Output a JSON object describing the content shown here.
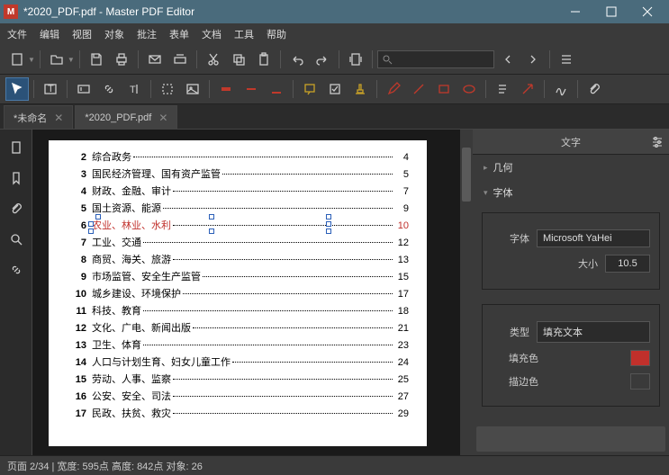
{
  "title": "*2020_PDF.pdf - Master PDF Editor",
  "menu": [
    "文件",
    "编辑",
    "视图",
    "对象",
    "批注",
    "表单",
    "文档",
    "工具",
    "帮助"
  ],
  "tabs": [
    {
      "label": "*未命名",
      "active": false
    },
    {
      "label": "*2020_PDF.pdf",
      "active": true
    }
  ],
  "toc": [
    {
      "n": "2",
      "t": "综合政务",
      "p": "4"
    },
    {
      "n": "3",
      "t": "国民经济管理、国有资产监管",
      "p": "5"
    },
    {
      "n": "4",
      "t": "财政、金融、审计",
      "p": "7"
    },
    {
      "n": "5",
      "t": "国土资源、能源",
      "p": "9"
    },
    {
      "n": "6",
      "t": "农业、林业、水利",
      "p": "10",
      "sel": true
    },
    {
      "n": "7",
      "t": "工业、交通",
      "p": "12"
    },
    {
      "n": "8",
      "t": "商贸、海关、旅游",
      "p": "13"
    },
    {
      "n": "9",
      "t": "市场监管、安全生产监管",
      "p": "15"
    },
    {
      "n": "10",
      "t": "城乡建设、环境保护",
      "p": "17"
    },
    {
      "n": "11",
      "t": "科技、教育",
      "p": "18"
    },
    {
      "n": "12",
      "t": "文化、广电、新闻出版",
      "p": "21"
    },
    {
      "n": "13",
      "t": "卫生、体育",
      "p": "23"
    },
    {
      "n": "14",
      "t": "人口与计划生育、妇女儿童工作",
      "p": "24"
    },
    {
      "n": "15",
      "t": "劳动、人事、监察",
      "p": "25"
    },
    {
      "n": "16",
      "t": "公安、安全、司法",
      "p": "27"
    },
    {
      "n": "17",
      "t": "民政、扶贫、救灾",
      "p": "29"
    }
  ],
  "panel": {
    "title": "文字",
    "sec1": "几何",
    "sec2": "字体",
    "fontLabel": "字体",
    "fontValue": "Microsoft YaHei",
    "sizeLabel": "大小",
    "sizeValue": "10.5",
    "typeLabel": "类型",
    "typeValue": "填充文本",
    "fillLabel": "填充色",
    "strokeLabel": "描边色",
    "fillColor": "#c0302b",
    "strokeColor": "#3a3a3a"
  },
  "status": "页面 2/34 | 宽度: 595点 高度: 842点 对象: 26"
}
